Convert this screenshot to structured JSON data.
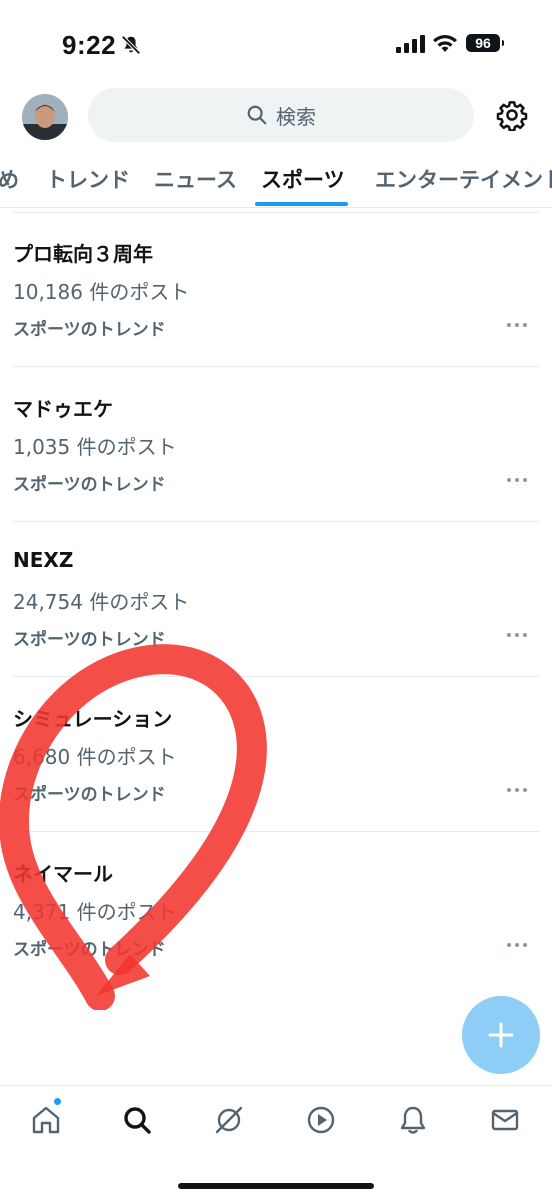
{
  "status_bar": {
    "time": "9:22",
    "battery": "96",
    "icons": [
      "bell-off-icon",
      "signal-icon",
      "wifi-icon",
      "battery-icon"
    ]
  },
  "header": {
    "search_label": "検索",
    "icons": [
      "avatar",
      "search-icon",
      "gear-icon"
    ]
  },
  "tabs": [
    {
      "label": "め",
      "active": false
    },
    {
      "label": "トレンド",
      "active": false
    },
    {
      "label": "ニュース",
      "active": false
    },
    {
      "label": "スポーツ",
      "active": true
    },
    {
      "label": "エンターテイメント",
      "active": false
    }
  ],
  "trends": [
    {
      "title": "プロ転向３周年",
      "count": "10,186 件のポスト",
      "category": "スポーツのトレンド"
    },
    {
      "title": "マドゥエケ",
      "count": "1,035 件のポスト",
      "category": "スポーツのトレンド"
    },
    {
      "title": "NEXZ",
      "count": "24,754 件のポスト",
      "category": "スポーツのトレンド"
    },
    {
      "title": "シミュレーション",
      "count": "6,680 件のポスト",
      "category": "スポーツのトレンド"
    },
    {
      "title": "ネイマール",
      "count": "4,371 件のポスト",
      "category": "スポーツのトレンド"
    }
  ],
  "colors": {
    "accent": "#1d9bf0",
    "fab": "#8ecdf6",
    "secondary_text": "#536471",
    "annotation": "#f2362f"
  },
  "bottom_nav": [
    "home-icon",
    "search-icon",
    "grok-icon",
    "video-icon",
    "notifications-icon",
    "messages-icon"
  ]
}
